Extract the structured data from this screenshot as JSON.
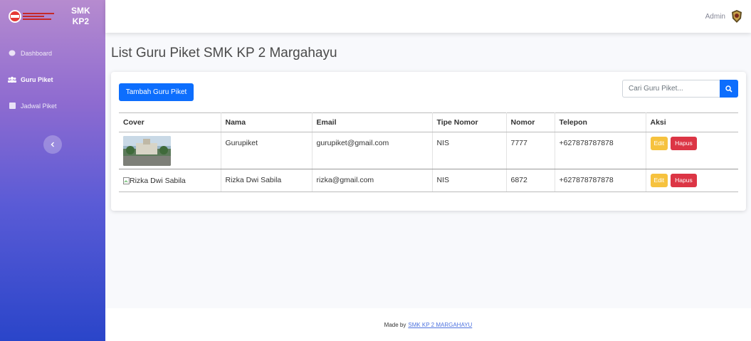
{
  "sidebar": {
    "brand_name_line1": "SMK",
    "brand_name_line2": "KP2",
    "items": [
      {
        "label": "Dashboard",
        "icon": "palette-icon"
      },
      {
        "label": "Guru Piket",
        "icon": "users-icon"
      },
      {
        "label": "Jadwal Piket",
        "icon": "table-icon"
      }
    ]
  },
  "topbar": {
    "user_name": "Admin"
  },
  "page": {
    "title": "List Guru Piket SMK KP 2 Margahayu"
  },
  "toolbar": {
    "add_label": "Tambah Guru Piket",
    "search_placeholder": "Cari Guru Piket..."
  },
  "table": {
    "headers": [
      "Cover",
      "Nama",
      "Email",
      "Tipe Nomor",
      "Nomor",
      "Telepon",
      "Aksi"
    ],
    "rows": [
      {
        "cover": "",
        "nama": "Gurupiket",
        "email": "gurupiket@gmail.com",
        "tipe": "NIS",
        "nomor": "7777",
        "telepon": "+627878787878"
      },
      {
        "cover": "Rizka Dwi Sabila",
        "nama": "Rizka Dwi Sabila",
        "email": "rizka@gmail.com",
        "tipe": "NIS",
        "nomor": "6872",
        "telepon": "+627878787878"
      }
    ],
    "edit_label": "Edit",
    "delete_label": "Hapus"
  },
  "footer": {
    "text": "Made by",
    "link": "SMK KP 2 MARGAHAYU"
  },
  "colors": {
    "primary": "#0d6efd",
    "warning": "#f6c23e",
    "danger": "#dc3545"
  }
}
